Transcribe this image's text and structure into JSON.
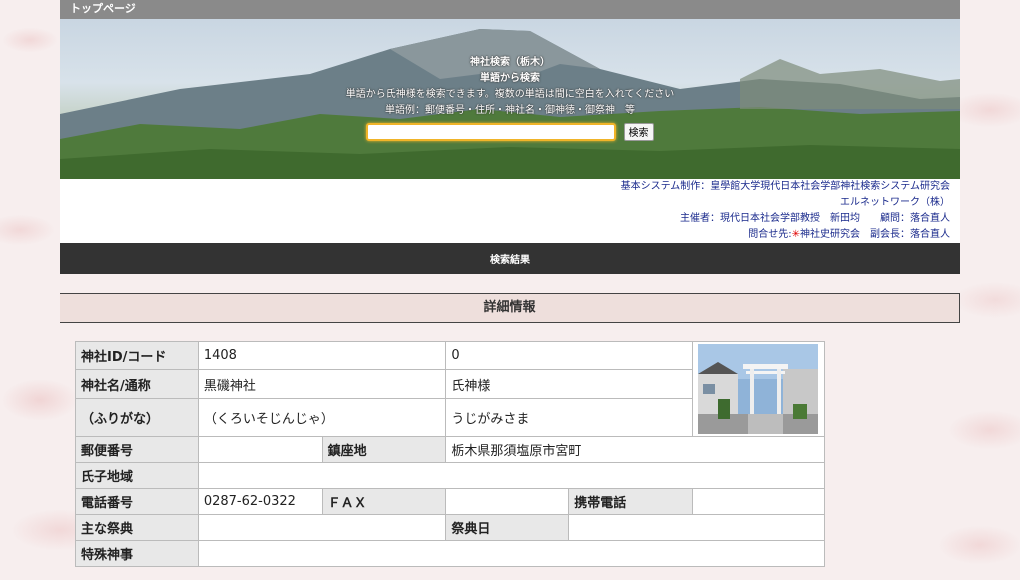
{
  "topbar": {
    "home_link": "トップページ"
  },
  "hero": {
    "title": "神社検索（栃木）",
    "subtitle": "単語から検索",
    "description": "単語から氏神様を検索できます。複数の単語は間に空白を入れてください",
    "example": "単語例：郵便番号・住所・神社名・御神徳・御祭神　等",
    "search_value": "",
    "search_button": "検索"
  },
  "credits": {
    "line1": "基本システム制作：皇學館大学現代日本社会学部神社検索システム研究会",
    "line2": "エルネットワーク（株）",
    "line3": "主催者：現代日本社会学部教授　新田均　　顧問：落合直人",
    "line4_prefix": "問合せ先:",
    "line4_link": "神社史研究会",
    "line4_suffix": "副会長：落合直人"
  },
  "results_bar": "検索結果",
  "detail_title": "詳細情報",
  "detail": {
    "id_label": "神社ID/コード",
    "id": "1408",
    "code": "0",
    "name_label": "神社名/通称",
    "name": "黒磯神社",
    "common_name": "氏神様",
    "kana_label": "（ふりがな）",
    "name_kana": "（くろいそじんじゃ）",
    "common_kana": "うじがみさま",
    "postal_label": "郵便番号",
    "postal": "",
    "location_label": "鎮座地",
    "location": "栃木県那須塩原市宮町",
    "parish_label": "氏子地域",
    "parish": "",
    "phone_label": "電話番号",
    "phone": "0287-62-0322",
    "fax_label": "ＦＡＸ",
    "fax": "",
    "mobile_label": "携帯電話",
    "mobile": "",
    "festival_label": "主な祭典",
    "festival": "",
    "festival_day_label": "祭典日",
    "festival_day": "",
    "special_label": "特殊神事",
    "special": ""
  }
}
